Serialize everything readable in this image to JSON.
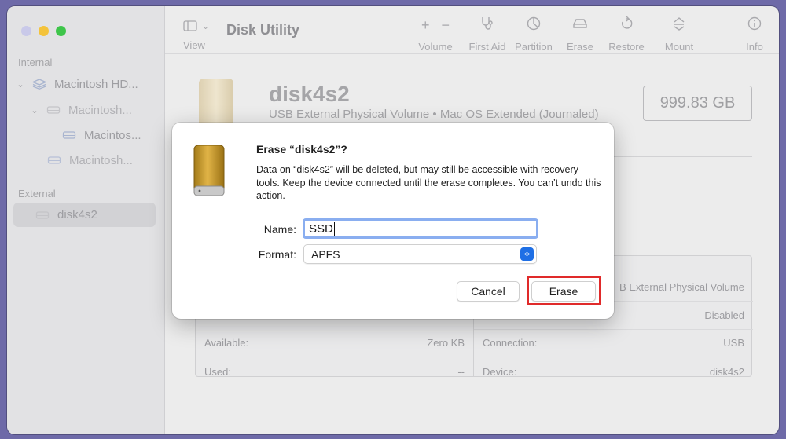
{
  "colors": {
    "accent": "#1f6fe5",
    "highlight": "#e02a2a",
    "close": "#c9c9e9",
    "minimize": "#f4c33b",
    "zoom": "#3ec54a"
  },
  "sidebar": {
    "internal_label": "Internal",
    "external_label": "External",
    "items": [
      {
        "label": "Macintosh HD...",
        "icon": "stack-icon"
      },
      {
        "label": "Macintosh...",
        "icon": "drive-icon"
      },
      {
        "label": "Macintos...",
        "icon": "drive-icon"
      },
      {
        "label": "Macintosh...",
        "icon": "drive-icon"
      },
      {
        "label": "disk4s2",
        "icon": "drive-icon"
      }
    ]
  },
  "toolbar": {
    "title": "Disk Utility",
    "view_label": "View",
    "volume_label": "Volume",
    "first_aid_label": "First Aid",
    "partition_label": "Partition",
    "erase_label": "Erase",
    "restore_label": "Restore",
    "mount_label": "Mount",
    "info_label": "Info"
  },
  "disk": {
    "name": "disk4s2",
    "description": "USB External Physical Volume • Mac OS Extended (Journaled)",
    "size": "999.83 GB"
  },
  "info": {
    "rows": [
      {
        "left_label": "",
        "left_value": "",
        "right_label": "",
        "right_value": "B External Physical Volume"
      },
      {
        "left_label": "",
        "left_value": "",
        "right_label": "",
        "right_value": "Disabled"
      },
      {
        "left_label": "Available:",
        "left_value": "Zero KB",
        "right_label": "Connection:",
        "right_value": "USB"
      },
      {
        "left_label": "Used:",
        "left_value": "--",
        "right_label": "Device:",
        "right_value": "disk4s2"
      }
    ]
  },
  "dialog": {
    "title": "Erase “disk4s2”?",
    "message": "Data on “disk4s2” will be deleted, but may still be accessible with recovery tools. Keep the device connected until the erase completes. You can’t undo this action.",
    "name_label": "Name:",
    "name_value": "SSD",
    "format_label": "Format:",
    "format_value": "APFS",
    "cancel_label": "Cancel",
    "erase_label": "Erase"
  }
}
